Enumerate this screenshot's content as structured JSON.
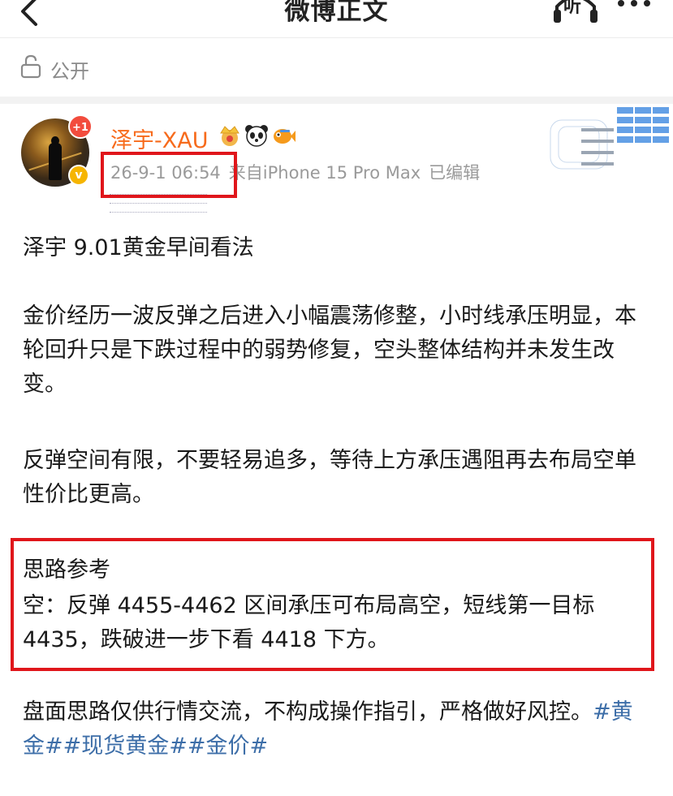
{
  "header": {
    "title": "微博正文",
    "listen_label": "听"
  },
  "visibility": {
    "label": "公开"
  },
  "author": {
    "name": "泽宇-XAU",
    "notification_badge": "+1",
    "verified_badge": "v",
    "timestamp": "26-9-1 06:54",
    "source": "来自iPhone 15 Pro Max",
    "edited": "已编辑"
  },
  "post": {
    "title": "泽宇 9.01黄金早间看法",
    "paragraph_1": "金价经历一波反弹之后进入小幅震荡修整，小时线承压明显，本轮回升只是下跌过程中的弱势修复，空头整体结构并未发生改变。",
    "paragraph_2": "反弹空间有限，不要轻易追多，等待上方承压遇阻再去布局空单性价比更高。",
    "strategy_heading": "思路参考",
    "strategy_text": "空：反弹 4455-4462 区间承压可布局高空，短线第一目标 4435，跌破进一步下看 4418 下方。",
    "disclaimer": "盘面思路仅供行情交流，不构成操作指引，严格做好风控。",
    "hashtags": [
      "#黄金#",
      "#现货黄金#",
      "#金价#"
    ]
  },
  "colors": {
    "author_name": "#f76b1c",
    "hashtag": "#3d6ea8",
    "highlight_box": "#e0161b",
    "meta_text": "#9a9a9a"
  },
  "icons": [
    "back-arrow-icon",
    "headphones-icon",
    "more-icon",
    "lock-icon",
    "crown-emoji-icon",
    "panda-emoji-icon",
    "fish-emoji-icon"
  ]
}
